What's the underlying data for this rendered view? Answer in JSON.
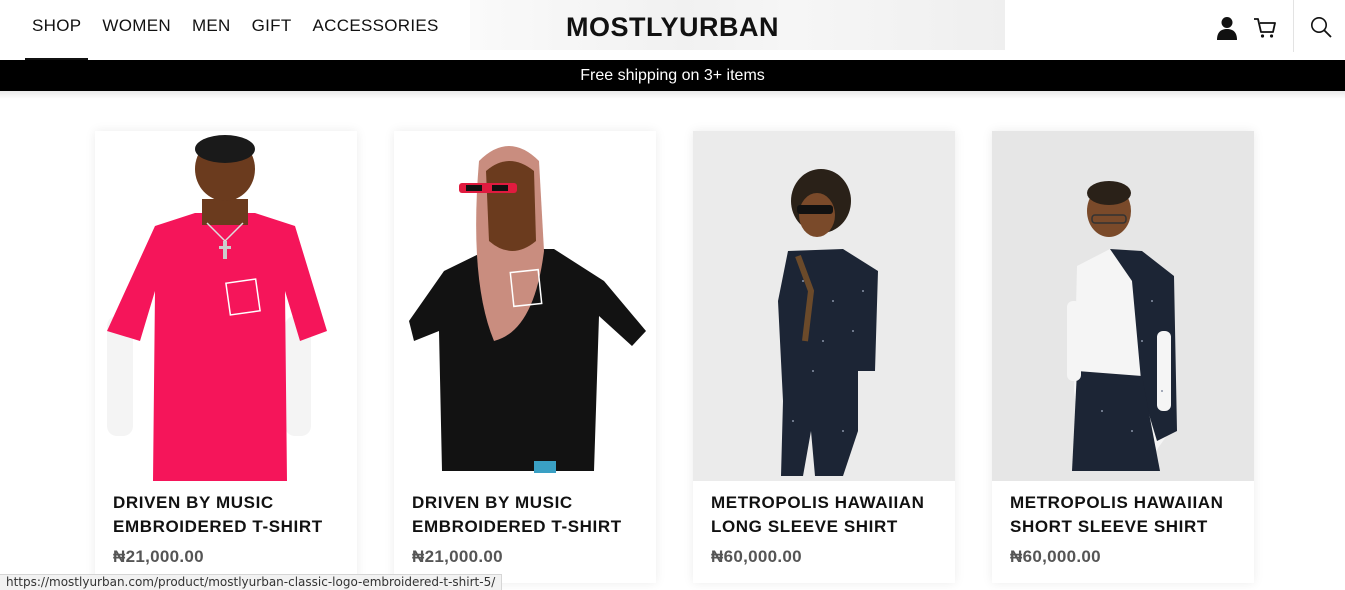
{
  "header": {
    "nav": [
      "SHOP",
      "WOMEN",
      "MEN",
      "GIFT",
      "ACCESSORIES"
    ],
    "logo": "MOSTLYURBAN",
    "icons": [
      "user-icon",
      "cart-icon",
      "search-icon"
    ]
  },
  "banner": {
    "text": "Free shipping on 3+ items"
  },
  "products": [
    {
      "title_line1": "DRIVEN BY MUSIC",
      "title_line2": "EMBROIDERED T-SHIRT",
      "price": "₦21,000.00",
      "shirt_color": "#f5155a",
      "bg": "#ffffff"
    },
    {
      "title_line1": "DRIVEN BY MUSIC",
      "title_line2": "EMBROIDERED T-SHIRT",
      "price": "₦21,000.00",
      "shirt_color": "#111111",
      "bg": "#ffffff"
    },
    {
      "title_line1": "METROPOLIS HAWAIIAN",
      "title_line2": "LONG SLEEVE SHIRT",
      "price": "₦60,000.00",
      "shirt_color": "#1c2535",
      "bg": "#ebebeb"
    },
    {
      "title_line1": "METROPOLIS HAWAIIAN",
      "title_line2": "SHORT SLEEVE SHIRT",
      "price": "₦60,000.00",
      "shirt_color": "#1c2535",
      "bg": "#e6e6e6"
    }
  ],
  "status_bar": {
    "url": "https://mostlyurban.com/product/mostlyurban-classic-logo-embroidered-t-shirt-5/"
  },
  "colors": {
    "banner_bg": "#000000",
    "banner_text": "#ffffff",
    "price": "#555555"
  }
}
